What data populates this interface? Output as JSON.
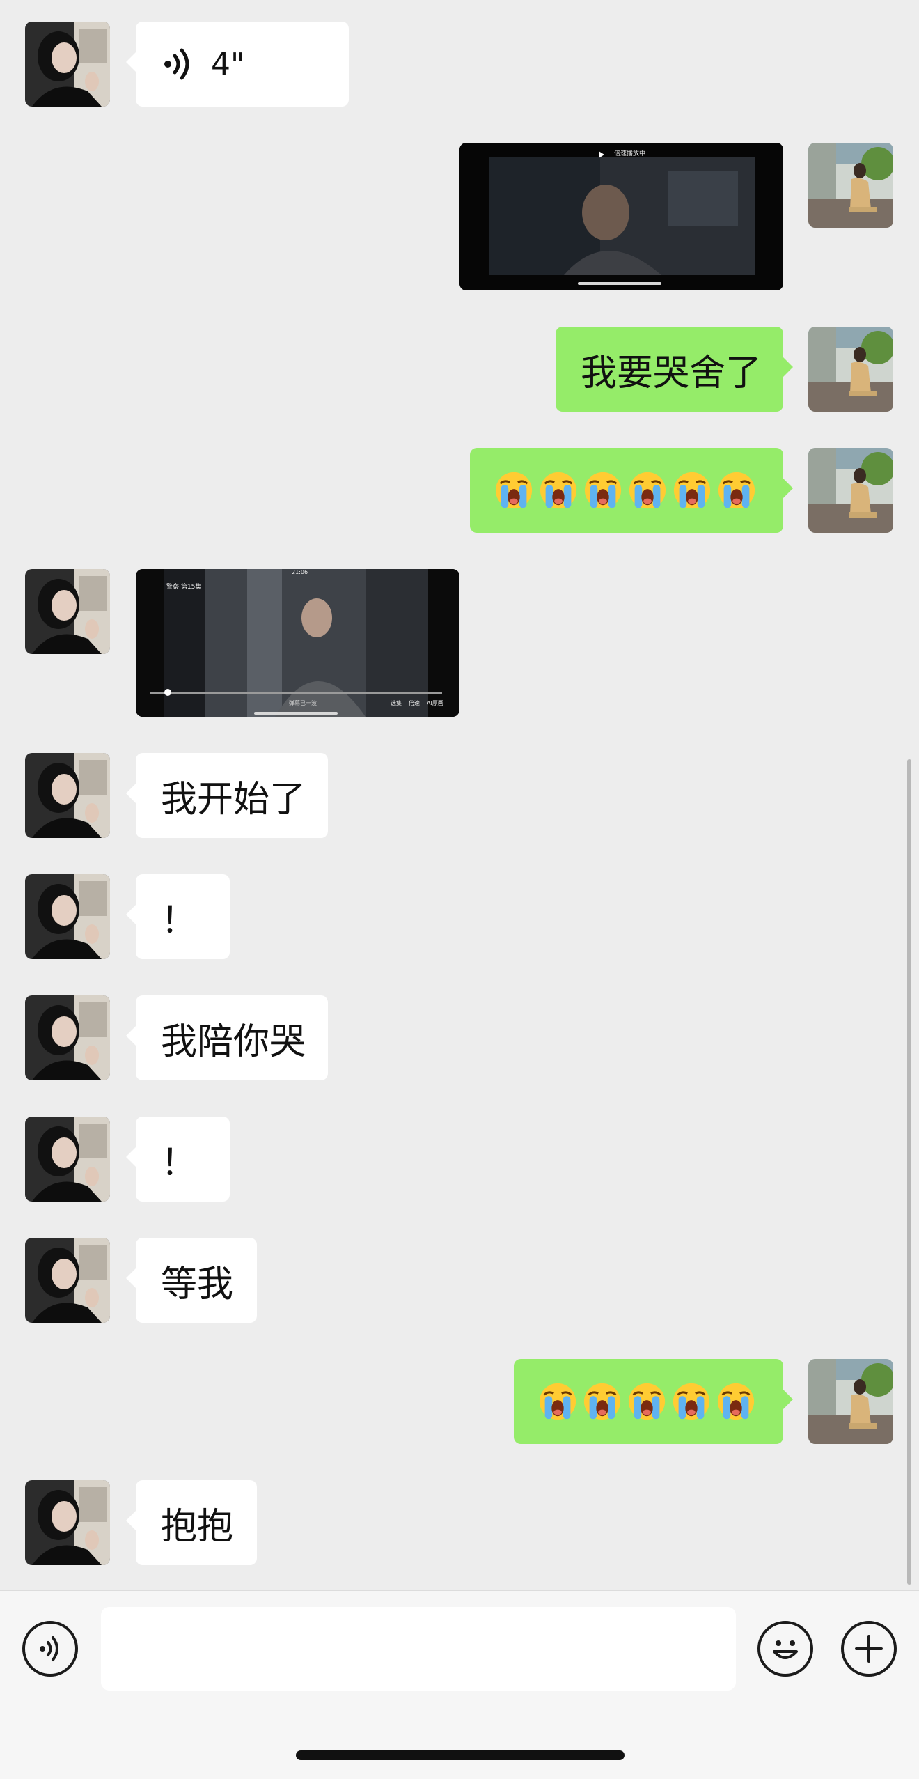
{
  "messages": [
    {
      "side": "in",
      "type": "voice",
      "text": "4\""
    },
    {
      "side": "out",
      "type": "video"
    },
    {
      "side": "out",
      "type": "text",
      "text": "我要哭舍了"
    },
    {
      "side": "out",
      "type": "emoji",
      "emoji": "loudly-crying-face",
      "count": 6
    },
    {
      "side": "in",
      "type": "image"
    },
    {
      "side": "in",
      "type": "text",
      "text": "我开始了"
    },
    {
      "side": "in",
      "type": "text",
      "text": "！"
    },
    {
      "side": "in",
      "type": "text",
      "text": "我陪你哭"
    },
    {
      "side": "in",
      "type": "text",
      "text": "！"
    },
    {
      "side": "in",
      "type": "text",
      "text": "等我"
    },
    {
      "side": "out",
      "type": "emoji",
      "emoji": "loudly-crying-face",
      "count": 5
    },
    {
      "side": "in",
      "type": "text",
      "text": "抱抱"
    }
  ],
  "video_message": {
    "overlay_text": "倍速播放中"
  },
  "image_message": {
    "header_text": "警察 第15集",
    "status_time": "21:06",
    "bottom_hint": "弹幕已一波",
    "controls": [
      "选集",
      "倍速",
      "AI原画"
    ]
  },
  "input_bar": {
    "voice_icon": "voice-icon",
    "emoji_icon": "smiley-icon",
    "more_icon": "plus-icon",
    "placeholder": ""
  },
  "colors": {
    "background": "#ededed",
    "bubble_in": "#ffffff",
    "bubble_out": "#95ec69",
    "input_bar": "#f6f6f6"
  }
}
